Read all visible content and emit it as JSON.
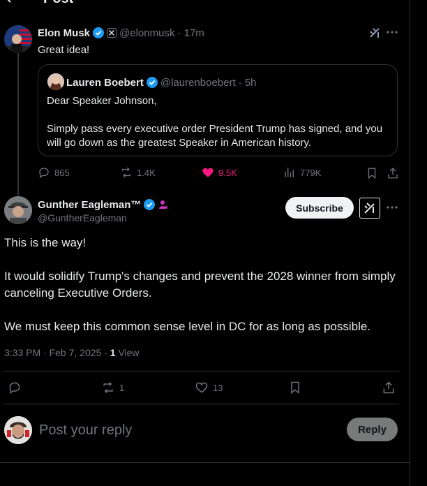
{
  "header": {
    "title": "Post"
  },
  "thread_post": {
    "name": "Elon Musk",
    "handle": "@elonmusk",
    "time": "· 17m",
    "text": "Great idea!",
    "quote": {
      "name": "Lauren Boebert",
      "handle": "@laurenboebert",
      "time": "· 5h",
      "line1": "Dear Speaker Johnson,",
      "line2": "Simply pass every executive order President Trump has signed, and you will go down as the greatest Speaker in American history."
    },
    "stats": {
      "replies": "865",
      "reposts": "1.4K",
      "likes": "9.5K",
      "views": "779K"
    },
    "colors": {
      "like": "#f91880",
      "verified": "#1d9bf0"
    }
  },
  "main_post": {
    "name": "Gunther Eagleman™",
    "handle": "@GuntherEagleman",
    "subscribe_label": "Subscribe",
    "paragraphs": [
      "This is the way!",
      "It would solidify Trump's changes and prevent the 2028 winner from simply canceling Executive Orders.",
      "We must keep this common sense level in DC for as long as possible."
    ],
    "timestamp": "3:33 PM · Feb 7, 2025 ·",
    "view_count": "1",
    "view_label": "View",
    "stats": {
      "reposts": "1",
      "likes": "13"
    }
  },
  "reply_box": {
    "placeholder": "Post your reply",
    "button_label": "Reply"
  }
}
